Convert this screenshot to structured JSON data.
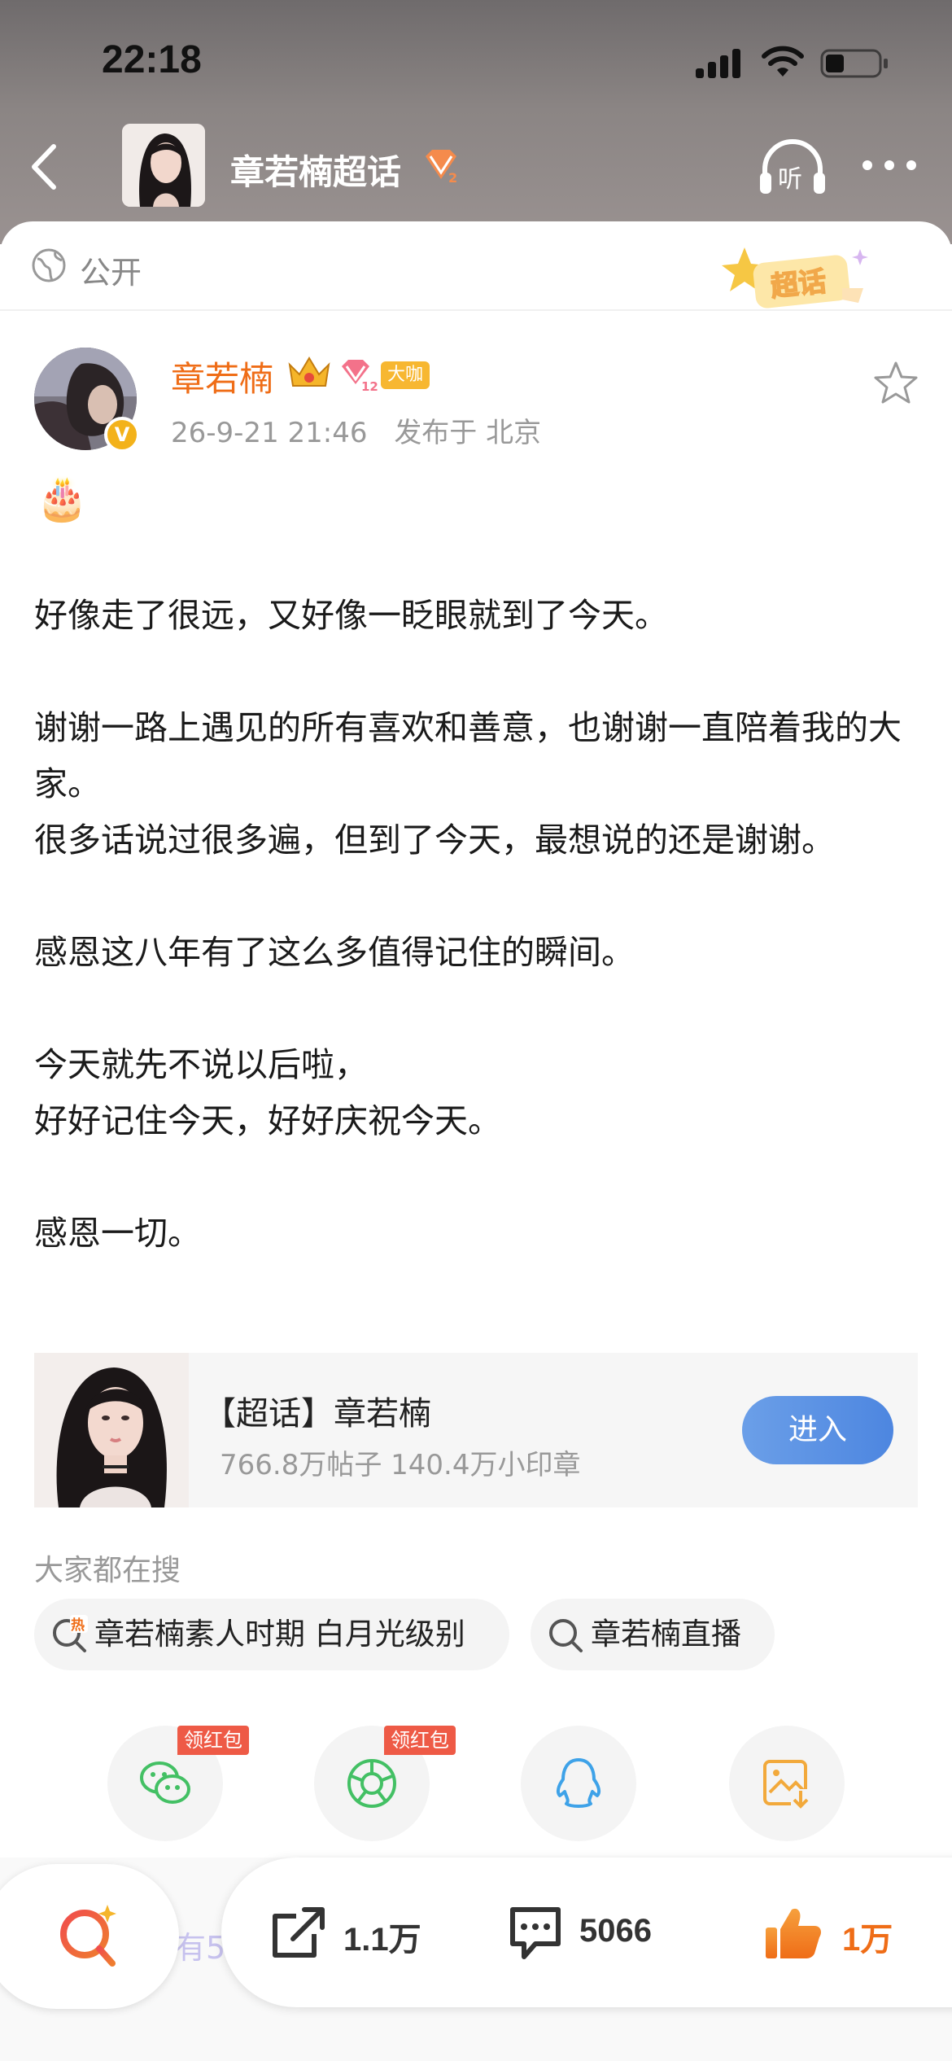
{
  "status_bar": {
    "time": "22:18"
  },
  "nav": {
    "title": "章若楠超话",
    "level_badge": "2"
  },
  "visibility": {
    "text": "公开",
    "sticker": "超话"
  },
  "author": {
    "name": "章若楠",
    "verified": "V",
    "badge": "大咖",
    "gem_level": "12",
    "date": "26-9-21 21:46",
    "location": "发布于 北京"
  },
  "post": {
    "emoji": "🎂",
    "paragraphs": [
      [
        "好像走了很远，又好像一眨眼就到了今天。"
      ],
      [
        "谢谢一路上遇见的所有喜欢和善意，也谢谢一直陪着我的大家。",
        "很多话说过很多遍，但到了今天，最想说的还是谢谢。"
      ],
      [
        "感恩这八年有了这么多值得记住的瞬间。"
      ],
      [
        "今天就先不说以后啦，",
        "好好记住今天，好好庆祝今天。"
      ],
      [
        "感恩一切。"
      ]
    ]
  },
  "topic_card": {
    "title": "【超话】章若楠",
    "stats": "766.8万帖子 140.4万小印章",
    "enter_label": "进入"
  },
  "search": {
    "heading": "大家都在搜",
    "chips": [
      "章若楠素人时期 白月光级别",
      "章若楠直播"
    ],
    "hot_label": "热"
  },
  "share": {
    "red_packet_label": "领红包"
  },
  "bottom": {
    "ghost_text": "有5",
    "share_count": "1.1万",
    "comment_count": "5066",
    "like_count": "1万"
  },
  "colors": {
    "accent_orange": "#ef6d17",
    "enter_blue": "#4d86e0",
    "red_tag": "#ee5a46"
  }
}
